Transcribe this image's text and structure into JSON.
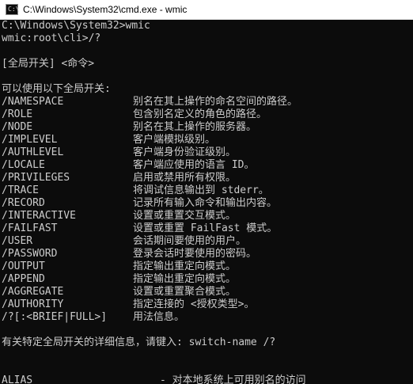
{
  "window": {
    "title": "C:\\Windows\\System32\\cmd.exe - wmic",
    "icon": "console-icon"
  },
  "console": {
    "line1": "C:\\Windows\\System32>wmic",
    "line2": "wmic:root\\cli>/?",
    "usage": "[全局开关] <命令>",
    "switches_header": "可以使用以下全局开关:",
    "switches": [
      {
        "name": "/NAMESPACE",
        "desc": "别名在其上操作的命名空间的路径。"
      },
      {
        "name": "/ROLE",
        "desc": "包含别名定义的角色的路径。"
      },
      {
        "name": "/NODE",
        "desc": "别名在其上操作的服务器。"
      },
      {
        "name": "/IMPLEVEL",
        "desc": "客户端模拟级别。"
      },
      {
        "name": "/AUTHLEVEL",
        "desc": "客户端身份验证级别。"
      },
      {
        "name": "/LOCALE",
        "desc": "客户端应使用的语言 ID。"
      },
      {
        "name": "/PRIVILEGES",
        "desc": "启用或禁用所有权限。"
      },
      {
        "name": "/TRACE",
        "desc": "将调试信息输出到 stderr。"
      },
      {
        "name": "/RECORD",
        "desc": "记录所有输入命令和输出内容。"
      },
      {
        "name": "/INTERACTIVE",
        "desc": "设置或重置交互模式。"
      },
      {
        "name": "/FAILFAST",
        "desc": "设置或重置 FailFast 模式。"
      },
      {
        "name": "/USER",
        "desc": "会话期间要使用的用户。"
      },
      {
        "name": "/PASSWORD",
        "desc": "登录会话时要使用的密码。"
      },
      {
        "name": "/OUTPUT",
        "desc": "指定输出重定向模式。"
      },
      {
        "name": "/APPEND",
        "desc": "指定输出重定向模式。"
      },
      {
        "name": "/AGGREGATE",
        "desc": "设置或重置聚合模式。"
      },
      {
        "name": "/AUTHORITY",
        "desc": "指定连接的 <授权类型>。"
      },
      {
        "name": "/?[:<BRIEF|FULL>]",
        "desc": "用法信息。"
      }
    ],
    "help_hint": "有关特定全局开关的详细信息，请键入: switch-name /?",
    "alias_name": "ALIAS",
    "alias_desc": "- 对本地系统上可用别名的访问"
  }
}
